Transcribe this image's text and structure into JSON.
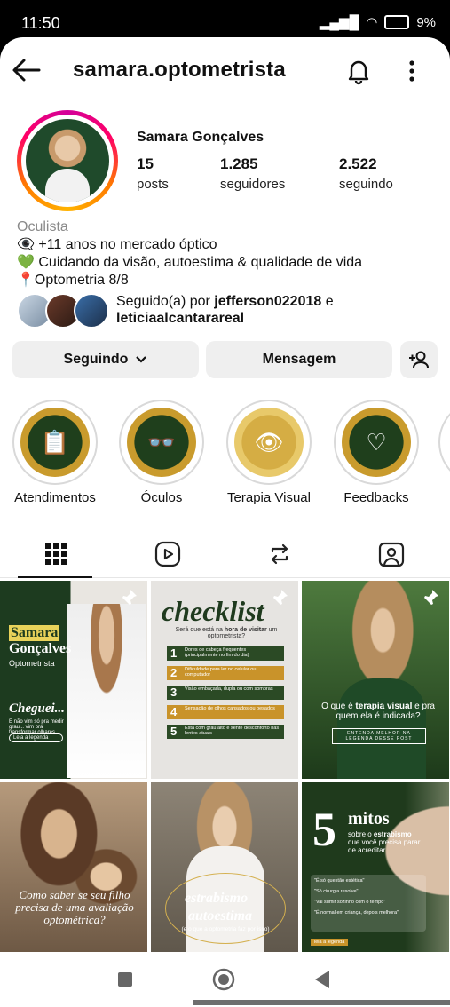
{
  "status_bar": {
    "time": "11:50",
    "battery": "9%"
  },
  "header": {
    "username": "samara.optometrista"
  },
  "profile": {
    "full_name": "Samara Gonçalves",
    "posts_count": "15",
    "posts_label": "posts",
    "followers_count": "1.285",
    "followers_label": "seguidores",
    "following_count": "2.522",
    "following_label": "seguindo",
    "category": "Oculista",
    "bio_lines": [
      "👁‍🗨 +11 anos no mercado óptico",
      "💚 Cuidando da visão, autoestima & qualidade de vida",
      "📍Optometria 8/8"
    ],
    "followed_by_prefix": "Seguido(a) por ",
    "followed_by_user1": "jefferson022018",
    "followed_by_and": " e",
    "followed_by_user2": "leticiaalcantarareal"
  },
  "buttons": {
    "following": "Seguindo",
    "message": "Mensagem"
  },
  "highlights": [
    {
      "label": "Atendimentos",
      "icon": "clipboard-icon"
    },
    {
      "label": "Óculos",
      "icon": "glasses-icon"
    },
    {
      "label": "Terapia Visual",
      "icon": "eye-icon"
    },
    {
      "label": "Feedbacks",
      "icon": "heart-eye-icon"
    }
  ],
  "tabs": [
    "grid-icon",
    "reels-icon",
    "repost-icon",
    "tagged-icon"
  ],
  "posts": {
    "p1_name1": "Samara",
    "p1_name2": "Gonçalves",
    "p1_sub": "Optometrista",
    "p1_title": "Cheguei...",
    "p1_body": "E não vim só pra medir grau... vim pra transformar olhares.",
    "p1_btn": "Leia a legenda",
    "p2_title": "checklist",
    "p2_q1": "Será que está na ",
    "p2_q2": "hora de visitar",
    "p2_q3": " um optometrista?",
    "p2_items": [
      "Dores de cabeça frequentes (principalmente no fim do dia)",
      "Dificuldade para ler no celular ou computador",
      "Visão embaçada, dupla ou com sombras",
      "Sensação de olhos cansados ou pesados",
      "Está com grau alto e sente desconforto nas lentes atuais"
    ],
    "p3_text1": "O que é ",
    "p3_text2": "terapia visual",
    "p3_text3": " e pra quem ela é indicada?",
    "p3_btn": "ENTENDA MELHOR NA LEGENDA DESSE POST",
    "p4_text": "Como saber se seu filho precisa de uma avaliação optométrica?",
    "p5_title1": "estrabismo",
    "p5_title2": "autoestima",
    "p5_sub": "(e o que a optometria faz por isso)",
    "p6_num": "5",
    "p6_title": "mitos",
    "p6_sub1": "sobre o ",
    "p6_sub2": "estrabismo",
    "p6_sub3": " que você precisa parar de acreditar",
    "p6_items": [
      "\"É só questão estética\"",
      "\"Só cirurgia resolve\"",
      "\"Vai sumir sozinho com o tempo\"",
      "\"É normal em criança, depois melhora\""
    ],
    "p6_btn": "leia a legenda"
  }
}
